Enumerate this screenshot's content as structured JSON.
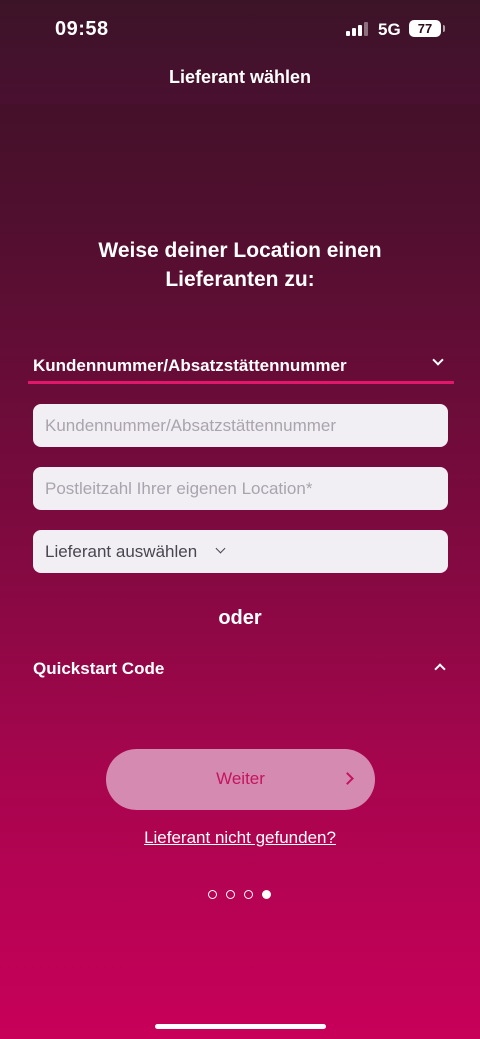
{
  "status_bar": {
    "time": "09:58",
    "network": "5G",
    "battery": "77"
  },
  "nav": {
    "title": "Lieferant wählen"
  },
  "heading": {
    "line1": "Weise deiner Location einen",
    "line2": "Lieferanten zu:"
  },
  "customer_number_section": {
    "label": "Kundennummer/Absatzstättennummer",
    "expanded": true,
    "customer_number_field": {
      "value": "",
      "placeholder": "Kundennummer/Absatzstättennummer"
    },
    "postcode_field": {
      "value": "",
      "placeholder": "Postleitzahl Ihrer eigenen Location*"
    },
    "supplier_select": {
      "label": "Lieferant auswählen"
    }
  },
  "separator": {
    "text": "oder"
  },
  "quickstart_section": {
    "label": "Quickstart Code",
    "expanded": false
  },
  "next_button": {
    "label": "Weiter"
  },
  "not_found_link": {
    "label": "Lieferant nicht gefunden?"
  },
  "pagination": {
    "total": 4,
    "current": 4
  },
  "colors": {
    "accent": "#e2176c",
    "button_bg": "#d58bb1",
    "button_text": "#c4145f",
    "gradient_top": "#3a1226",
    "gradient_bottom": "#c8005a"
  }
}
